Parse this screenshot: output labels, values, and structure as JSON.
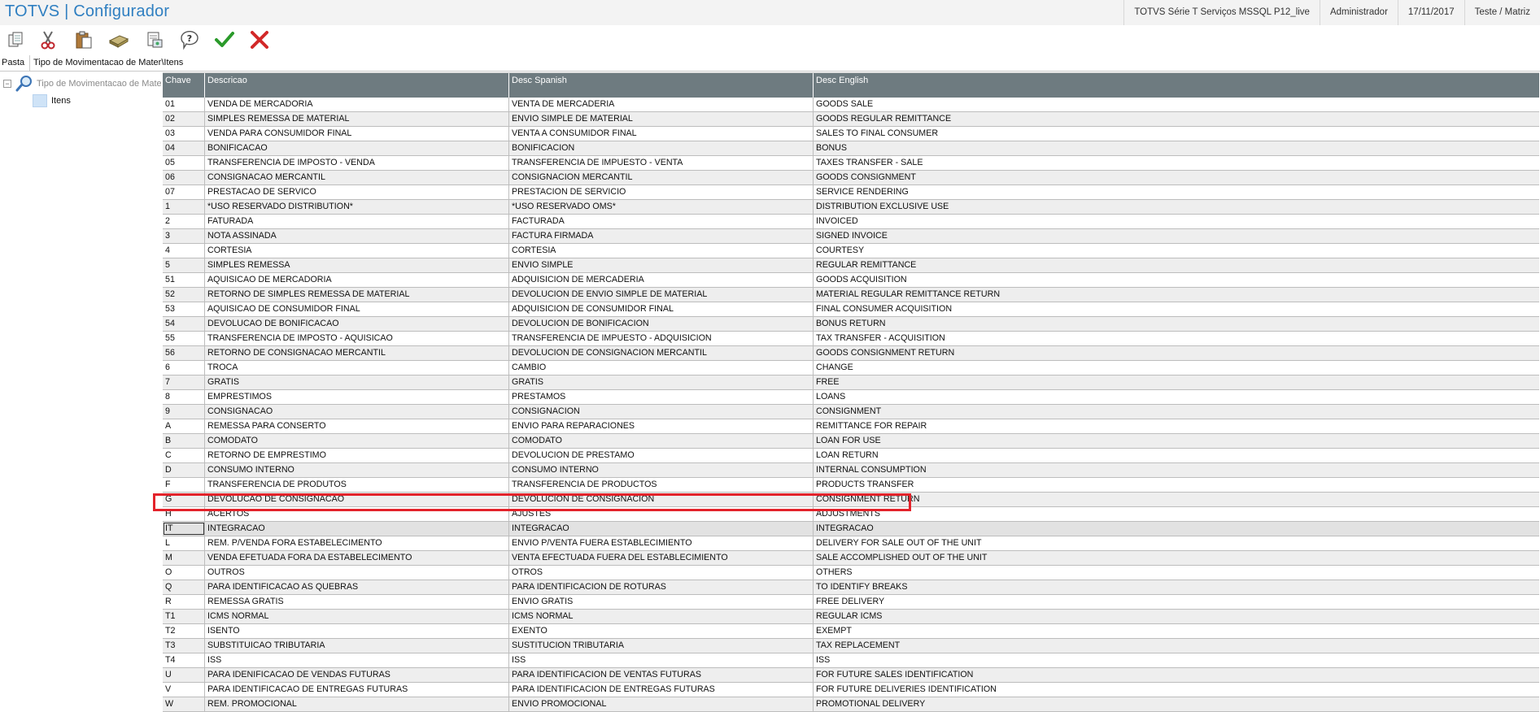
{
  "header": {
    "title": "TOTVS | Configurador",
    "environment": "TOTVS Série T Serviços MSSQL P12_live",
    "user": "Administrador",
    "date": "17/11/2017",
    "company": "Teste / Matriz"
  },
  "toolbar": {
    "buttons": [
      "copy-icon",
      "cut-icon",
      "paste-icon",
      "book-icon",
      "print-icon",
      "help-icon",
      "confirm-icon",
      "cancel-icon"
    ]
  },
  "tabs": {
    "pasta": "Pasta",
    "breadcrumb": "Tipo de Movimentacao de Mater\\Itens"
  },
  "tree": {
    "root_label": "Tipo de Movimentacao de Materiais",
    "child_label": "Itens"
  },
  "grid": {
    "columns": [
      "Chave",
      "Descricao",
      "Desc Spanish",
      "Desc English"
    ],
    "rows": [
      [
        "01",
        "VENDA DE MERCADORIA",
        "VENTA DE MERCADERIA",
        "GOODS SALE"
      ],
      [
        "02",
        "SIMPLES REMESSA DE MATERIAL",
        "ENVIO SIMPLE DE MATERIAL",
        "GOODS REGULAR REMITTANCE"
      ],
      [
        "03",
        "VENDA PARA CONSUMIDOR FINAL",
        "VENTA A CONSUMIDOR FINAL",
        "SALES TO FINAL CONSUMER"
      ],
      [
        "04",
        "BONIFICACAO",
        "BONIFICACION",
        "BONUS"
      ],
      [
        "05",
        "TRANSFERENCIA DE IMPOSTO - VENDA",
        "TRANSFERENCIA DE IMPUESTO - VENTA",
        "TAXES TRANSFER - SALE"
      ],
      [
        "06",
        "CONSIGNACAO MERCANTIL",
        "CONSIGNACION MERCANTIL",
        "GOODS CONSIGNMENT"
      ],
      [
        "07",
        "PRESTACAO DE SERVICO",
        "PRESTACION DE SERVICIO",
        "SERVICE RENDERING"
      ],
      [
        "1",
        "*USO RESERVADO DISTRIBUTION*",
        "*USO RESERVADO OMS*",
        "DISTRIBUTION EXCLUSIVE USE"
      ],
      [
        "2",
        "FATURADA",
        "FACTURADA",
        "INVOICED"
      ],
      [
        "3",
        "NOTA ASSINADA",
        "FACTURA FIRMADA",
        "SIGNED INVOICE"
      ],
      [
        "4",
        "CORTESIA",
        "CORTESIA",
        "COURTESY"
      ],
      [
        "5",
        "SIMPLES REMESSA",
        "ENVIO SIMPLE",
        "REGULAR REMITTANCE"
      ],
      [
        "51",
        "AQUISICAO DE MERCADORIA",
        "ADQUISICION DE MERCADERIA",
        "GOODS ACQUISITION"
      ],
      [
        "52",
        "RETORNO DE SIMPLES REMESSA DE MATERIAL",
        "DEVOLUCION DE ENVIO SIMPLE DE MATERIAL",
        "MATERIAL REGULAR REMITTANCE RETURN"
      ],
      [
        "53",
        "AQUISICAO DE CONSUMIDOR FINAL",
        "ADQUISICION DE CONSUMIDOR FINAL",
        "FINAL CONSUMER ACQUISITION"
      ],
      [
        "54",
        "DEVOLUCAO DE BONIFICACAO",
        "DEVOLUCION DE BONIFICACION",
        "BONUS RETURN"
      ],
      [
        "55",
        "TRANSFERENCIA DE IMPOSTO - AQUISICAO",
        "TRANSFERENCIA DE IMPUESTO - ADQUISICION",
        "TAX TRANSFER - ACQUISITION"
      ],
      [
        "56",
        "RETORNO DE CONSIGNACAO MERCANTIL",
        "DEVOLUCION DE CONSIGNACION MERCANTIL",
        "GOODS CONSIGNMENT RETURN"
      ],
      [
        "6",
        "TROCA",
        "CAMBIO",
        "CHANGE"
      ],
      [
        "7",
        "GRATIS",
        "GRATIS",
        "FREE"
      ],
      [
        "8",
        "EMPRESTIMOS",
        "PRESTAMOS",
        "LOANS"
      ],
      [
        "9",
        "CONSIGNACAO",
        "CONSIGNACION",
        "CONSIGNMENT"
      ],
      [
        "A",
        "REMESSA PARA CONSERTO",
        "ENVIO PARA REPARACIONES",
        "REMITTANCE FOR REPAIR"
      ],
      [
        "B",
        "COMODATO",
        "COMODATO",
        "LOAN FOR USE"
      ],
      [
        "C",
        "RETORNO DE EMPRESTIMO",
        "DEVOLUCION DE PRESTAMO",
        "LOAN RETURN"
      ],
      [
        "D",
        "CONSUMO INTERNO",
        "CONSUMO INTERNO",
        "INTERNAL CONSUMPTION"
      ],
      [
        "F",
        "TRANSFERENCIA DE PRODUTOS",
        "TRANSFERENCIA DE PRODUCTOS",
        "PRODUCTS TRANSFER"
      ],
      [
        "G",
        "DEVOLUCAO DE CONSIGNACAO",
        "DEVOLUCION DE CONSIGNACION",
        "CONSIGNMENT RETURN"
      ],
      [
        "H",
        "ACERTOS",
        "AJUSTES",
        "ADJUSTMENTS"
      ],
      [
        "IT",
        "INTEGRACAO",
        "INTEGRACAO",
        "INTEGRACAO"
      ],
      [
        "L",
        "REM. P/VENDA FORA ESTABELECIMENTO",
        "ENVIO P/VENTA FUERA ESTABLECIMIENTO",
        "DELIVERY FOR SALE OUT OF THE UNIT"
      ],
      [
        "M",
        "VENDA EFETUADA FORA DA ESTABELECIMENTO",
        "VENTA EFECTUADA FUERA DEL ESTABLECIMIENTO",
        "SALE ACCOMPLISHED OUT OF THE UNIT"
      ],
      [
        "O",
        "OUTROS",
        "OTROS",
        "OTHERS"
      ],
      [
        "Q",
        "PARA IDENTIFICACAO AS QUEBRAS",
        "PARA IDENTIFICACION DE ROTURAS",
        "TO IDENTIFY BREAKS"
      ],
      [
        "R",
        "REMESSA GRATIS",
        "ENVIO GRATIS",
        "FREE DELIVERY"
      ],
      [
        "T1",
        "ICMS NORMAL",
        "ICMS NORMAL",
        "REGULAR ICMS"
      ],
      [
        "T2",
        "ISENTO",
        "EXENTO",
        "EXEMPT"
      ],
      [
        "T3",
        "SUBSTITUICAO TRIBUTARIA",
        "SUSTITUCION TRIBUTARIA",
        "TAX REPLACEMENT"
      ],
      [
        "T4",
        "ISS",
        "ISS",
        "ISS"
      ],
      [
        "U",
        "PARA IDENIFICACAO DE VENDAS FUTURAS",
        "PARA IDENTIFICACION DE VENTAS FUTURAS",
        "FOR FUTURE SALES IDENTIFICATION"
      ],
      [
        "V",
        "PARA IDENTIFICACAO DE ENTREGAS FUTURAS",
        "PARA IDENTIFICACION DE ENTREGAS FUTURAS",
        "FOR FUTURE DELIVERIES IDENTIFICATION"
      ],
      [
        "W",
        "REM. PROMOCIONAL",
        "ENVIO PROMOCIONAL",
        "PROMOTIONAL DELIVERY"
      ]
    ],
    "selected_row_index": 29
  },
  "colors": {
    "title": "#2f7fc1",
    "grid_header": "#6e7b80",
    "highlight": "#e3232b"
  }
}
